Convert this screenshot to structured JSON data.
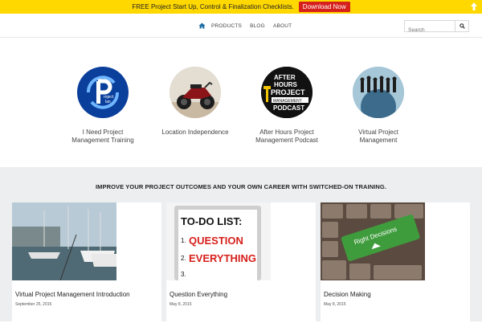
{
  "promo": {
    "text": "FREE Project Start Up, Control & Finalization Checklists.",
    "button": "Download Now"
  },
  "nav": {
    "items": [
      {
        "label": "PRODUCTS"
      },
      {
        "label": "BLOG"
      },
      {
        "label": "ABOUT"
      }
    ],
    "search_placeholder": "Search"
  },
  "features": [
    {
      "label_line1": "I Need Project",
      "label_line2": "Management Training"
    },
    {
      "label_line1": "Location Independence",
      "label_line2": ""
    },
    {
      "label_line1": "After Hours Project",
      "label_line2": "Management Podcast"
    },
    {
      "label_line1": "Virtual Project",
      "label_line2": "Management"
    }
  ],
  "tagline": "IMPROVE YOUR PROJECT OUTCOMES AND YOUR OWN CAREER WITH SWITCHED-ON TRAINING.",
  "posts": [
    {
      "title": "Virtual Project Management Introduction",
      "date": "September 25, 2015"
    },
    {
      "title": "Question Everything",
      "date": "May 8, 2015"
    },
    {
      "title": "Decision Making",
      "date": "May 8, 2015"
    }
  ],
  "images": {
    "logo_text_line1": "roject",
    "logo_text_line2": "lan",
    "podcast_line1": "AFTER",
    "podcast_line2": "HOURS",
    "podcast_line3": "PROJECT",
    "podcast_line4": "MANAGEMENT",
    "podcast_line5": "PODCAST",
    "todo_title": "TO-DO LIST:",
    "todo_item1": "QUESTION",
    "todo_item2": "EVERYTHING",
    "keyboard_text": "Right Decisions"
  },
  "colors": {
    "promo_bg": "#ffd800",
    "promo_button": "#d6201c",
    "nav_accent": "#1f6fa3",
    "lower_bg": "#eceeef"
  }
}
